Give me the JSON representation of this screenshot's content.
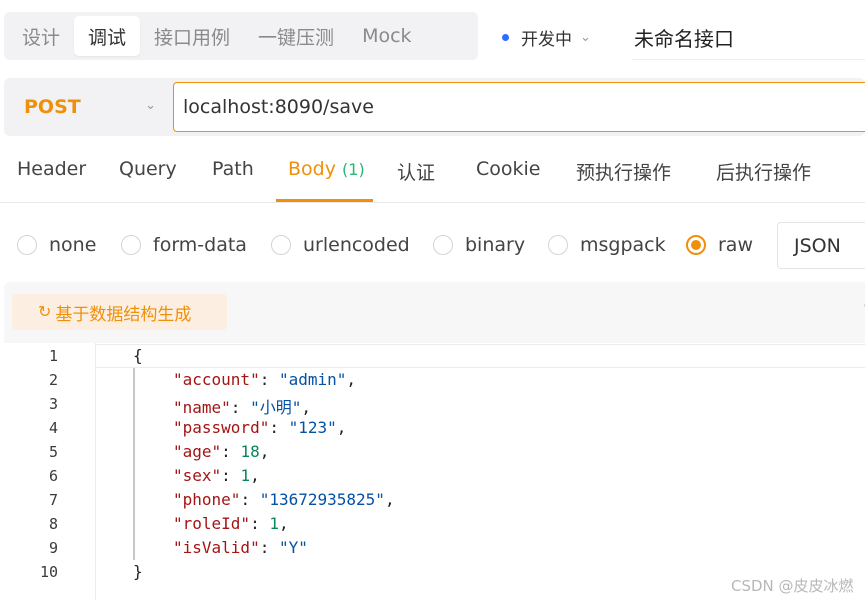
{
  "mode_tabs": [
    "设计",
    "调试",
    "接口用例",
    "一键压测",
    "Mock"
  ],
  "active_mode_tab": "调试",
  "environment": {
    "label": "开发中",
    "dot_color": "#2f6bff"
  },
  "api_name": "未命名接口",
  "request": {
    "method": "POST",
    "method_color": "#f0900a",
    "url": "localhost:8090/save"
  },
  "request_tabs": {
    "header": "Header",
    "query": "Query",
    "path": "Path",
    "body": "Body",
    "body_count": "(1)",
    "auth": "认证",
    "cookie": "Cookie",
    "pre_ops": "预执行操作",
    "post_ops": "后执行操作"
  },
  "body_types": {
    "none": "none",
    "form_data": "form-data",
    "urlencoded": "urlencoded",
    "binary": "binary",
    "msgpack": "msgpack",
    "raw": "raw",
    "selected": "raw"
  },
  "raw_format": "JSON",
  "generate_button": "基于数据结构生成",
  "code": {
    "line_numbers": [
      "1",
      "2",
      "3",
      "4",
      "5",
      "6",
      "7",
      "8",
      "9",
      "10"
    ],
    "open_brace": "{",
    "close_brace": "}",
    "fields": [
      {
        "key": "\"account\"",
        "value": "\"admin\"",
        "value_type": "string",
        "trailing": ","
      },
      {
        "key": "\"name\"",
        "value": "\"小明\"",
        "value_type": "string",
        "trailing": ","
      },
      {
        "key": "\"password\"",
        "value": "\"123\"",
        "value_type": "string",
        "trailing": ","
      },
      {
        "key": "\"age\"",
        "value": "18",
        "value_type": "number",
        "trailing": ","
      },
      {
        "key": "\"sex\"",
        "value": "1",
        "value_type": "number",
        "trailing": ","
      },
      {
        "key": "\"phone\"",
        "value": "\"13672935825\"",
        "value_type": "string",
        "trailing": ","
      },
      {
        "key": "\"roleId\"",
        "value": "1",
        "value_type": "number",
        "trailing": ","
      },
      {
        "key": "\"isValid\"",
        "value": "\"Y\"",
        "value_type": "string",
        "trailing": ""
      }
    ]
  },
  "watermark": "CSDN @皮皮冰燃"
}
